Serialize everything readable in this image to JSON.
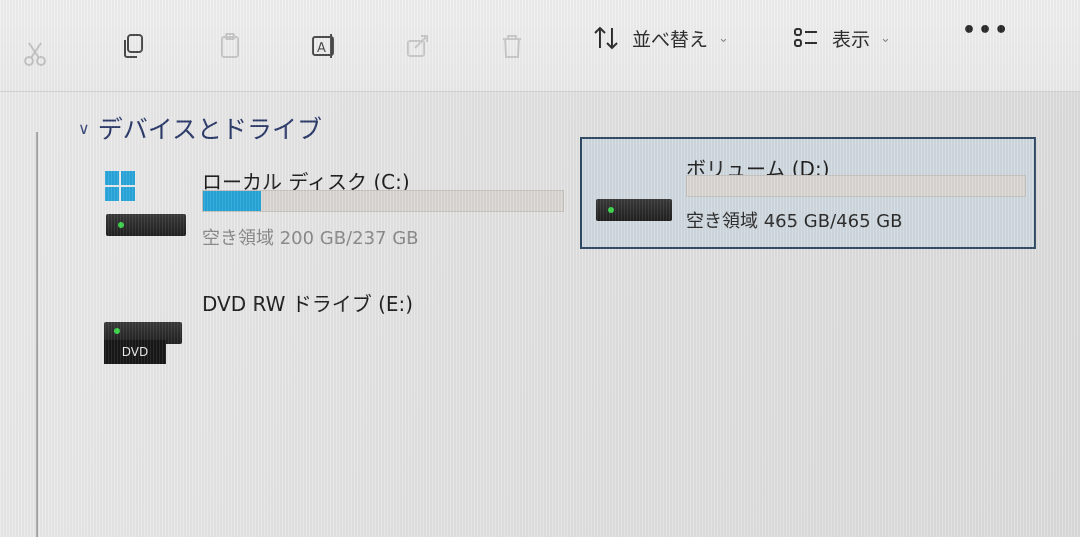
{
  "toolbar": {
    "sort_label": "並べ替え",
    "view_label": "表示",
    "more_label": "•••",
    "chevron": "⌄",
    "icons": [
      "cut-icon",
      "copy-icon",
      "paste-icon",
      "rename-icon",
      "share-icon",
      "delete-icon",
      "sort-icon",
      "view-icon"
    ]
  },
  "section": {
    "title": "デバイスとドライブ",
    "chevron": "∨"
  },
  "drives": [
    {
      "name": "ローカル ディスク (C:)",
      "free_text": "空き領域 200 GB/237 GB",
      "used_fraction": 0.16,
      "icon": "windows-drive-icon"
    },
    {
      "name": "ボリューム (D:)",
      "free_text": "空き領域 465 GB/465 GB",
      "used_fraction": 0.0,
      "icon": "hdd-icon",
      "selected": true
    },
    {
      "name": "DVD RW ドライブ (E:)",
      "device_label": "DVD",
      "icon": "dvd-drive-icon"
    }
  ],
  "colors": {
    "accent_fill": "#27a6d9",
    "header_text": "#2b3a6a",
    "selection_border": "#2f4a63",
    "selection_bg": "#d2dbe2",
    "led": "#3dd64c"
  }
}
